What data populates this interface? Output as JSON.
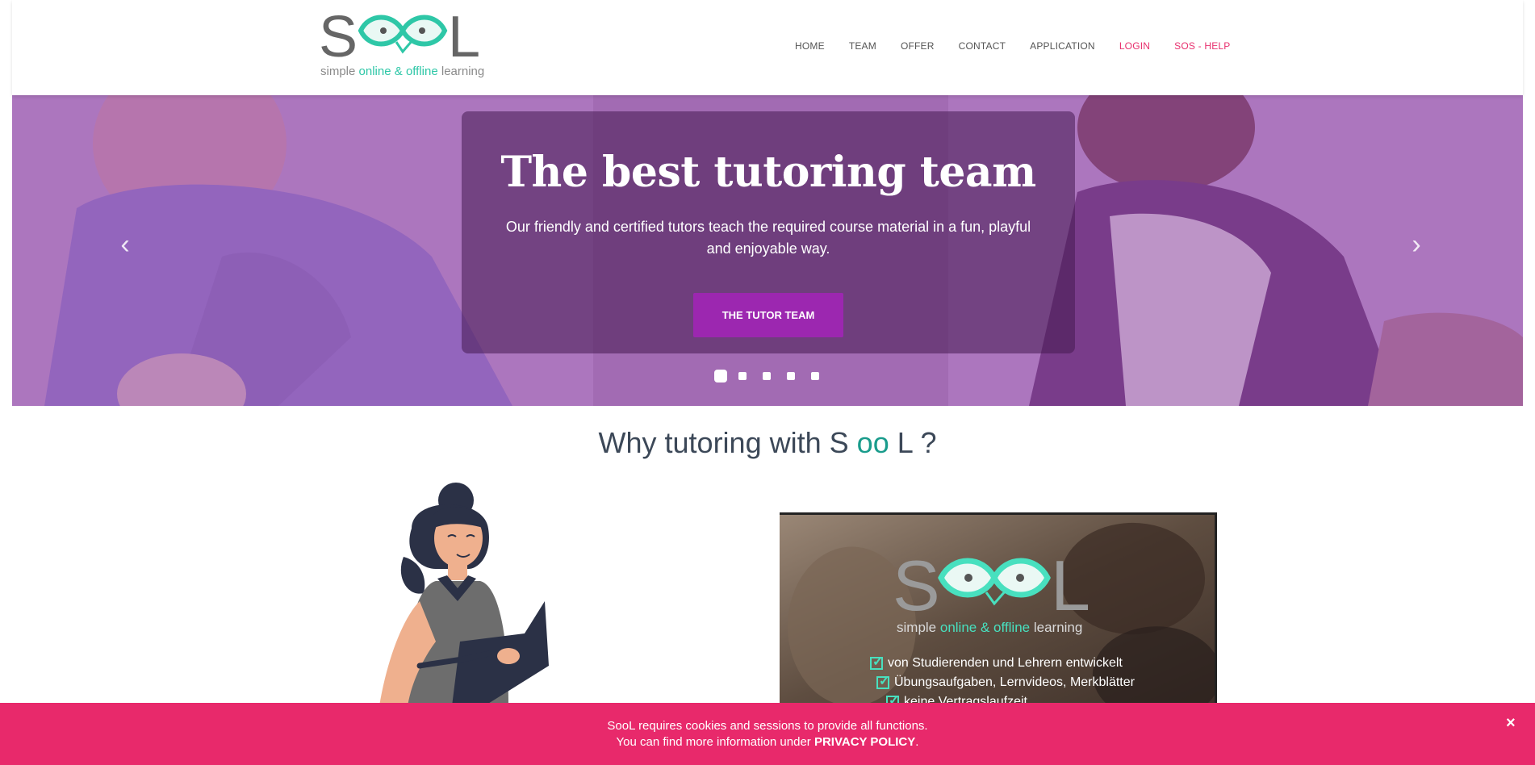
{
  "brand": {
    "logo_name": "SooL",
    "tagline_simple": "simple",
    "tagline_online": "online",
    "tagline_amp": "&",
    "tagline_offline": "offline",
    "tagline_learning": "learning",
    "colors": {
      "teal": "#2ec7a7",
      "pink": "#e8306e",
      "purple": "#9c27b0",
      "grey": "#666666"
    }
  },
  "nav": {
    "items": [
      {
        "label": "HOME"
      },
      {
        "label": "TEAM"
      },
      {
        "label": "OFFER"
      },
      {
        "label": "CONTACT"
      },
      {
        "label": "APPLICATION"
      },
      {
        "label": "LOGIN"
      },
      {
        "label": "SOS - HELP"
      }
    ]
  },
  "hero": {
    "title": "The best tutoring team",
    "text": "Our friendly and certified tutors teach the required course material in a fun, playful and enjoyable way.",
    "button_label": "THE TUTOR TEAM",
    "prev_icon": "chevron-left-icon",
    "next_icon": "chevron-right-icon",
    "slide_count": 5,
    "active_slide": 1
  },
  "why": {
    "prefix": "Why tutoring with",
    "s": "S",
    "oo": "oo",
    "l": "L",
    "suffix": "?"
  },
  "video": {
    "tag_simple": "simple",
    "tag_online": "online",
    "tag_amp": "&",
    "tag_offline": "offline",
    "tag_learning": "learning",
    "checks": [
      "von Studierenden und Lehrern entwickelt",
      "Übungsaufgaben, Lernvideos, Merkblätter",
      "keine Vertragslaufzeit"
    ]
  },
  "cookie": {
    "brand": "SooL",
    "line1_rest": "requires cookies and sessions to provide all functions.",
    "line2_prefix": "You can find more information under",
    "policy_link": "PRIVACY POLICY",
    "line2_suffix": ".",
    "close_label": "×"
  }
}
